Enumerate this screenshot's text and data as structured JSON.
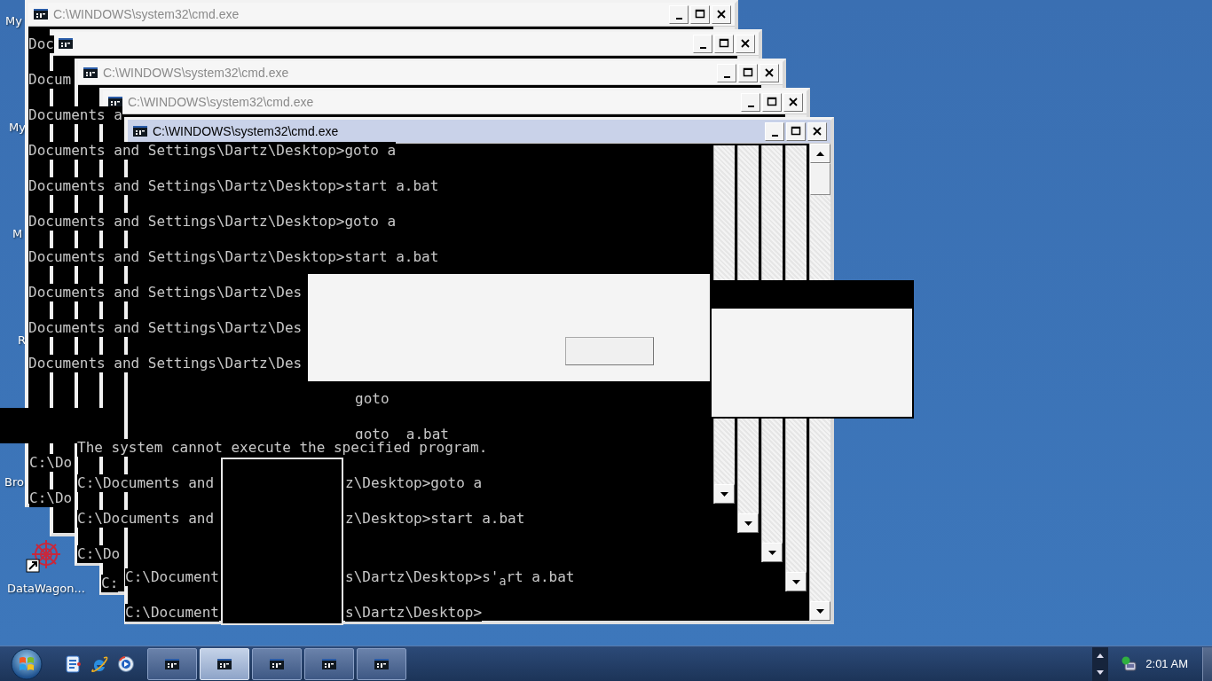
{
  "desktop_icons": [
    {
      "label": "My"
    },
    {
      "label": "My"
    },
    {
      "label": "M"
    },
    {
      "label": "R"
    },
    {
      "label": "Bro"
    },
    {
      "label": "DataWagon...",
      "kind": "shortcut"
    }
  ],
  "windows": [
    {
      "title": "C:\\WINDOWS\\system32\\cmd.exe",
      "active": false
    },
    {
      "active": false
    },
    {
      "title": "C:\\WINDOWS\\system32\\cmd.exe",
      "active": false
    },
    {
      "title": "C:\\WINDOWS\\system32\\cmd.exe",
      "active": false
    },
    {
      "title": "C:\\WINDOWS\\system32\\cmd.exe",
      "active": true
    }
  ],
  "console_top": [
    "Doc",
    "Docum",
    "Documents a",
    "Documents and Settings\\Dartz\\Desktop>goto a",
    "Documents and Settings\\Dartz\\Desktop>start a.bat",
    "Documents and Settings\\Dartz\\Desktop>goto a",
    "Documents and Settings\\Dartz\\Desktop>start a.bat",
    "Documents and Settings\\Dartz\\Des",
    "Documents and Settings\\Dartz\\Des",
    "Documents and Settings\\Dartz\\Des",
    "goto",
    "goto  a.bat"
  ],
  "console_bottom": [
    "The system cannot execute the specified program.",
    "C:\\Do",
    "C:\\Documents and",
    "z\\Desktop>goto a",
    "C:\\Do",
    "C:\\Documents and",
    "z\\Desktop>start a.bat",
    "C:\\Do",
    "C:",
    "C:\\Document",
    "s\\Dartz\\Desktop>s'$_{a}$rt a.bat",
    "C:\\Document",
    "s\\Dartz\\Desktop>"
  ],
  "taskbar": {
    "tasks": [
      {
        "selected": false
      },
      {
        "selected": true
      },
      {
        "selected": false
      },
      {
        "selected": false
      },
      {
        "selected": false
      }
    ],
    "clock": "2:01 AM"
  }
}
